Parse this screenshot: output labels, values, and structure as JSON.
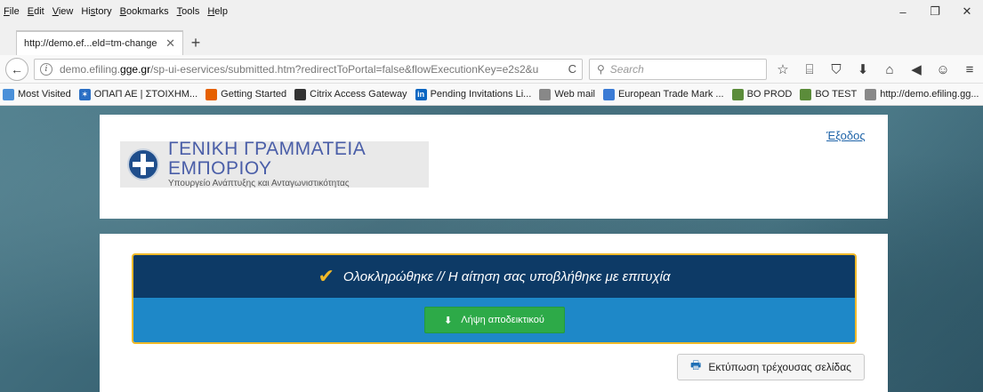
{
  "menubar": {
    "items": [
      {
        "pre": "",
        "key": "F",
        "post": "ile"
      },
      {
        "pre": "",
        "key": "E",
        "post": "dit"
      },
      {
        "pre": "",
        "key": "V",
        "post": "iew"
      },
      {
        "pre": "Hi",
        "key": "s",
        "post": "tory"
      },
      {
        "pre": "",
        "key": "B",
        "post": "ookmarks"
      },
      {
        "pre": "",
        "key": "T",
        "post": "ools"
      },
      {
        "pre": "",
        "key": "H",
        "post": "elp"
      }
    ],
    "minimize": "–",
    "restore": "❐",
    "close": "✕"
  },
  "tab": {
    "title": "http://demo.ef...eld=tm-change",
    "close": "✕",
    "new_tab": "+"
  },
  "navbar": {
    "back": "←",
    "info": "i",
    "url_prefix": "demo.efiling.",
    "url_domain": "gge.gr",
    "url_suffix": "/sp-ui-eservices/submitted.htm?redirectToPortal=false&flowExecutionKey=e2s2&u",
    "reload": "C",
    "search_placeholder": "Search",
    "search_icon": "⚲",
    "icons": [
      "☆",
      "⌸",
      "⛉",
      "⬇",
      "⌂",
      "◀",
      "☺",
      "≡"
    ]
  },
  "bookmarks": [
    {
      "label": "Most Visited",
      "color": "#4a90d9",
      "glyph": ""
    },
    {
      "label": "ΟΠΑΠ ΑΕ | ΣΤΟΙΧΗΜ...",
      "color": "#2b6fc4",
      "glyph": "✶"
    },
    {
      "label": "Getting Started",
      "color": "#e66000",
      "glyph": ""
    },
    {
      "label": "Citrix Access Gateway",
      "color": "#333333",
      "glyph": ""
    },
    {
      "label": "Pending Invitations  Li...",
      "color": "#0a66c2",
      "glyph": "in"
    },
    {
      "label": "Web mail",
      "color": "#888888",
      "glyph": ""
    },
    {
      "label": "European Trade Mark ...",
      "color": "#3a7bd5",
      "glyph": ""
    },
    {
      "label": "BO PROD",
      "color": "#5b8c3a",
      "glyph": ""
    },
    {
      "label": "BO TEST",
      "color": "#5b8c3a",
      "glyph": ""
    },
    {
      "label": "http://demo.efiling.gg...",
      "color": "#888888",
      "glyph": ""
    }
  ],
  "header": {
    "org_name": "ΓΕΝΙΚΗ ΓΡΑΜΜΑΤΕΙΑ ΕΜΠΟΡΙΟΥ",
    "org_subtitle": "Υπουργείο Ανάπτυξης και Ανταγωνιστικότητας",
    "logout": "Έξοδος"
  },
  "result": {
    "check": "✔",
    "message": "Ολοκληρώθηκε // Η αίτηση σας υποβλήθηκε με επιτυχία",
    "download_icon": "⬇",
    "download_label": "Λήψη αποδεικτικού",
    "print_icon": "🖶",
    "print_label": "Εκτύπωση τρέχουσας σελίδας"
  }
}
